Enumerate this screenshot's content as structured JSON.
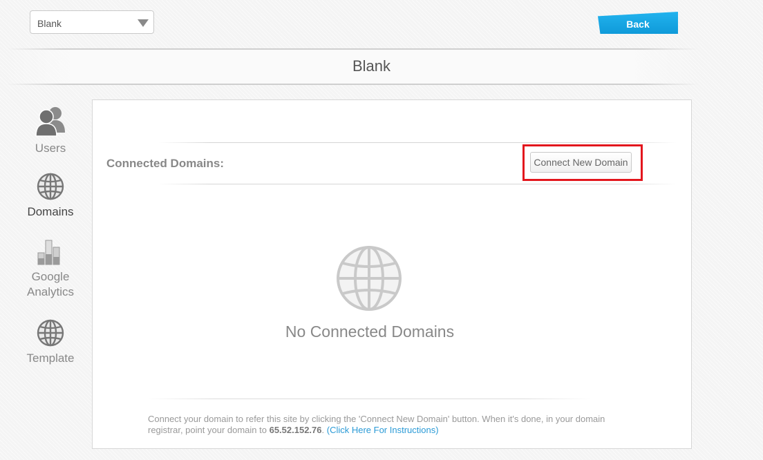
{
  "site_selector": {
    "value": "Blank"
  },
  "back_button": {
    "label": "Back"
  },
  "page": {
    "title": "Blank"
  },
  "sidebar": {
    "items": [
      {
        "label": "Users",
        "icon": "users-icon"
      },
      {
        "label": "Domains",
        "icon": "globe-icon",
        "active": true
      },
      {
        "label_line1": "Google",
        "label_line2": "Analytics",
        "icon": "bar-chart-icon"
      },
      {
        "label": "Template",
        "icon": "globe-icon"
      }
    ]
  },
  "domains_panel": {
    "heading": "Connected Domains:",
    "connect_button_label": "Connect New Domain",
    "empty_state_text": "No Connected Domains",
    "instructions": {
      "text_before_ip": "Connect your domain to refer this site by clicking the 'Connect New Domain' button. When it's done, in your domain registrar, point your domain to ",
      "ip": "65.52.152.76",
      "text_after_ip": ". ",
      "link_text": "(Click Here For Instructions)"
    }
  },
  "colors": {
    "accent_blue": "#1aa8e6",
    "highlight_red": "#e3161d"
  }
}
